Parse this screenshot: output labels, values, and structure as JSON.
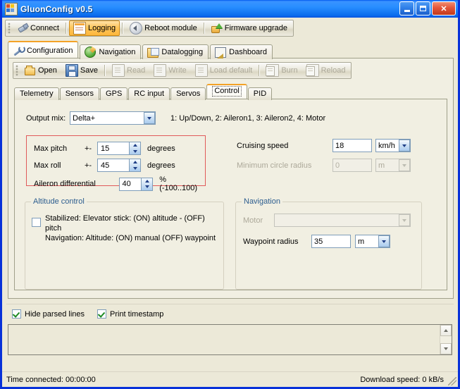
{
  "window": {
    "title": "GluonConfig v0.5",
    "icon": "app-icon",
    "buttons": {
      "minimize": "minimize",
      "maximize": "maximize",
      "close": "close"
    }
  },
  "main_toolbar": {
    "items": [
      {
        "label": "Connect",
        "icon": "plug-icon",
        "state": "normal"
      },
      {
        "label": "Logging",
        "icon": "logging-icon",
        "state": "active"
      },
      {
        "label": "Reboot module",
        "icon": "reboot-icon",
        "state": "normal"
      },
      {
        "label": "Firmware upgrade",
        "icon": "firmware-upgrade-icon",
        "state": "normal"
      }
    ]
  },
  "main_tabs": {
    "selected": "Configuration",
    "items": [
      {
        "label": "Configuration",
        "icon": "wrench-icon"
      },
      {
        "label": "Navigation",
        "icon": "globe-icon"
      },
      {
        "label": "Datalogging",
        "icon": "datalog-icon"
      },
      {
        "label": "Dashboard",
        "icon": "dashboard-icon"
      }
    ]
  },
  "file_toolbar": {
    "items": [
      {
        "label": "Open",
        "icon": "folder-open-icon",
        "enabled": true
      },
      {
        "label": "Save",
        "icon": "floppy-disk-icon",
        "enabled": true
      },
      {
        "label": "Read",
        "icon": "read-icon",
        "enabled": false
      },
      {
        "label": "Write",
        "icon": "write-icon",
        "enabled": false
      },
      {
        "label": "Load default",
        "icon": "document-icon",
        "enabled": false
      },
      {
        "label": "Burn",
        "icon": "burn-icon",
        "enabled": false
      },
      {
        "label": "Reload",
        "icon": "reload-icon",
        "enabled": false
      }
    ]
  },
  "config_tabs": {
    "selected": "Control",
    "items": [
      {
        "label": "Telemetry"
      },
      {
        "label": "Sensors"
      },
      {
        "label": "GPS"
      },
      {
        "label": "RC input"
      },
      {
        "label": "Servos"
      },
      {
        "label": "Control"
      },
      {
        "label": "PID"
      }
    ]
  },
  "control_panel": {
    "output_mix": {
      "label": "Output mix:",
      "value": "Delta+",
      "description": "1: Up/Down, 2: Aileron1, 3: Aileron2, 4: Motor"
    },
    "limits": {
      "max_pitch": {
        "label": "Max pitch",
        "prefix": "+-",
        "value": "15",
        "unit": "degrees"
      },
      "max_roll": {
        "label": "Max roll",
        "prefix": "+-",
        "value": "45",
        "unit": "degrees"
      },
      "aileron_differential": {
        "label": "Aileron differential",
        "value": "40",
        "unit": "% (-100..100)"
      }
    },
    "speed": {
      "cruising_speed": {
        "label": "Cruising speed",
        "value": "18",
        "unit": "km/h",
        "enabled": true
      },
      "minimum_circle_radius": {
        "label": "Minimum circle radius",
        "value": "0",
        "unit": "m",
        "enabled": false
      }
    },
    "altitude_control": {
      "title": "Altitude control",
      "checked": false,
      "line1": "Stabilized: Elevator stick: (ON) altitude - (OFF) pitch",
      "line2": "Navigation: Altitude: (ON) manual  (OFF) waypoint"
    },
    "navigation": {
      "title": "Navigation",
      "motor": {
        "label": "Motor",
        "value": "",
        "enabled": false
      },
      "waypoint_radius": {
        "label": "Waypoint radius",
        "value": "35",
        "unit": "m",
        "enabled": true
      }
    }
  },
  "log_options": {
    "hide_parsed_lines": {
      "label": "Hide parsed lines",
      "checked": true
    },
    "print_timestamp": {
      "label": "Print timestamp",
      "checked": true
    }
  },
  "log_output": {
    "text": ""
  },
  "statusbar": {
    "time_connected": "Time connected:  00:00:00",
    "download_speed": "Download speed:  0 kB/s"
  },
  "colors": {
    "title_blue": "#0a6ced",
    "window_border": "#0831d9",
    "face": "#ece9d8",
    "panel": "#f1efe2",
    "tab_accent": "#f3a227",
    "group_title": "#2c5d8f",
    "red_highlight": "#e05a5a",
    "active_toolbar": "#fdb73b",
    "disabled_text": "#aca899",
    "check_green": "#1d8a23"
  }
}
